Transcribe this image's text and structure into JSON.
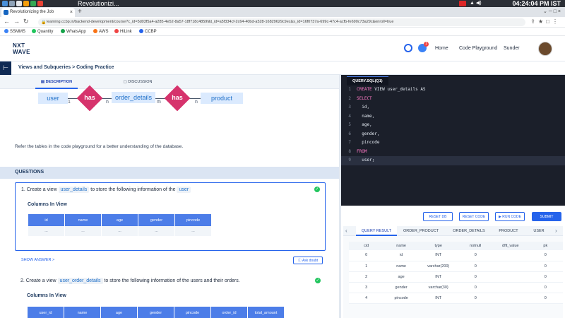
{
  "os": {
    "title": "Revolutionizi...",
    "clock": "04:24:04 PM IST"
  },
  "browser": {
    "tab_title": "Revolutionizing the Job",
    "new_tab": "+",
    "url": "learning.ccbp.in/backend-development/course?c_id=5d03f5a4-a285-4e52-8a57-18f718c4859f&t_id=a5f334cf-2c64-40bd-a528-16829629c9ec&s_id=16f0737a-699c-47c4-acfb-fe690c73a29c&enroll=true"
  },
  "bookmarks": [
    {
      "label": "SSMMS",
      "color": "#3b82f6"
    },
    {
      "label": "Quantity",
      "color": "#22c55e"
    },
    {
      "label": "WhatsApp",
      "color": "#16a34a"
    },
    {
      "label": "AWS",
      "color": "#f97316"
    },
    {
      "label": "HiLink",
      "color": "#ef4444"
    },
    {
      "label": "CCBP",
      "color": "#2563eb"
    }
  ],
  "header": {
    "logo_line1": "NXT",
    "logo_line2": "WAVE",
    "notif_count": "1",
    "nav_home": "Home",
    "nav_playground": "Code Playground",
    "user": "Sunder"
  },
  "breadcrumb": "Views and Subqueries > Coding Practice",
  "desc_tabs": {
    "description": "DESCRIPTION",
    "discussion": "DISCUSSION"
  },
  "er": {
    "entity1": "user",
    "rel1": "has",
    "entity2": "order_details",
    "rel2": "has",
    "entity3": "product",
    "card1": "1",
    "card2": "n",
    "card3": "m",
    "card4": "n"
  },
  "refer_text": "Refer the tables in the code playground for a better understanding of the database.",
  "questions_heading": "QUESTIONS",
  "q1": {
    "prefix": "1.  Create a view",
    "code1": "user_details",
    "mid": "to store the following information of the",
    "code2": "user",
    "columns_label": "Columns In View",
    "columns": [
      "id",
      "name",
      "age",
      "gender",
      "pincode"
    ],
    "placeholder": "..."
  },
  "show_answer": "SHOW ANSWER >",
  "ask_doubt": "Ask doubt",
  "q2": {
    "prefix": "2.  Create a view",
    "code1": "user_order_details",
    "mid": "to store the following information of the users and their orders.",
    "columns_label": "Columns In View",
    "columns": [
      "user_id",
      "name",
      "age",
      "gender",
      "pincode",
      "order_id",
      "total_amount"
    ]
  },
  "editor": {
    "file_tab": "QUERY.SQL(Q1)",
    "lines": [
      {
        "n": "1",
        "kw": "CREATE",
        "rest": " VIEW user_details AS"
      },
      {
        "n": "2",
        "kw": "SELECT",
        "rest": ""
      },
      {
        "n": "3",
        "kw": "",
        "rest": "  id,"
      },
      {
        "n": "4",
        "kw": "",
        "rest": "  name,"
      },
      {
        "n": "5",
        "kw": "",
        "rest": "  age,"
      },
      {
        "n": "6",
        "kw": "",
        "rest": "  gender,"
      },
      {
        "n": "7",
        "kw": "",
        "rest": "  pincode"
      },
      {
        "n": "8",
        "kw": "FROM",
        "rest": ""
      },
      {
        "n": "9",
        "kw": "",
        "rest": "  user;"
      }
    ]
  },
  "buttons": {
    "reset_db": "RESET DB",
    "reset_code": "RESET CODE",
    "run_code": "▶ RUN CODE",
    "submit": "SUBMIT"
  },
  "result_tabs": [
    "QUERY RESULT",
    "ORDER_PRODUCT",
    "ORDER_DETAILS",
    "PRODUCT",
    "USER"
  ],
  "result_table": {
    "headers": [
      "cid",
      "name",
      "type",
      "notnull",
      "dflt_value",
      "pk"
    ],
    "rows": [
      [
        "0",
        "id",
        "INT",
        "0",
        "",
        "0"
      ],
      [
        "1",
        "name",
        "varchar(200)",
        "0",
        "",
        "0"
      ],
      [
        "2",
        "age",
        "INT",
        "0",
        "",
        "0"
      ],
      [
        "3",
        "gender",
        "varchar(30)",
        "0",
        "",
        "0"
      ],
      [
        "4",
        "pincode",
        "INT",
        "0",
        "",
        "0"
      ]
    ]
  }
}
